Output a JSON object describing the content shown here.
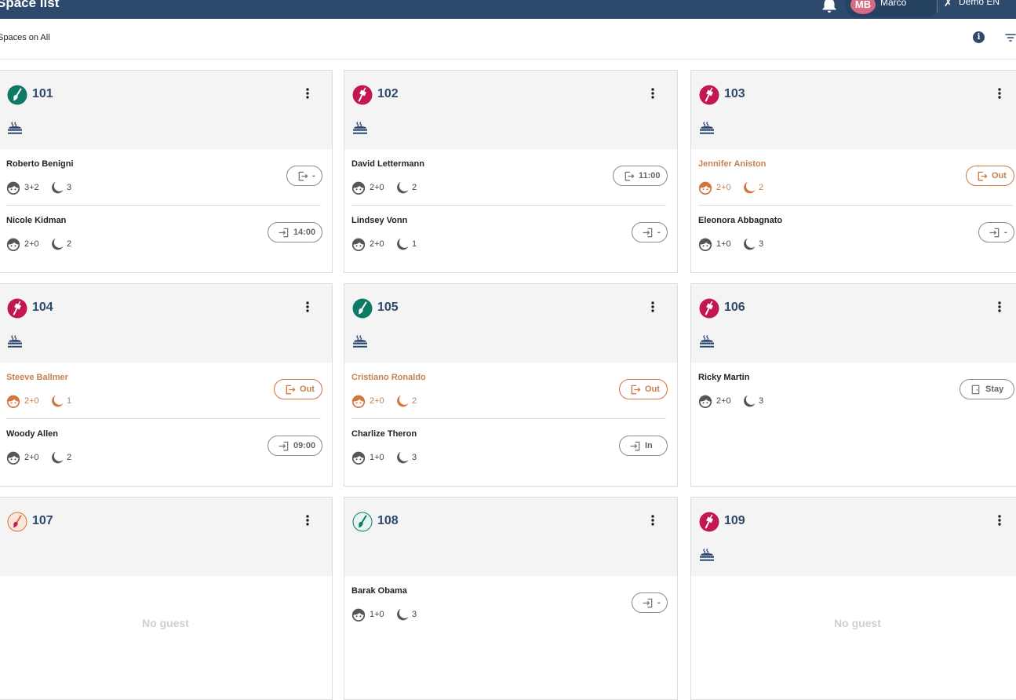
{
  "header": {
    "title": "Space list",
    "user_initials": "MB",
    "user_name": "Marco",
    "hotel": "Demo EN"
  },
  "subheader": {
    "label": "Spaces on All"
  },
  "colors": {
    "primary": "#2d4a6d",
    "dirty": "#c2184f",
    "clean": "#0d7a68",
    "accent_orange": "#d2763f"
  },
  "rooms": [
    {
      "number": "101",
      "status": "clean-icon",
      "bed": true,
      "no_guest": "",
      "guests": [
        {
          "name": "Roberto Benigni",
          "people": "3+2",
          "nights": "3",
          "action": "-",
          "icon": "checkout-icon",
          "highlight": false
        },
        {
          "name": "Nicole Kidman",
          "people": "2+0",
          "nights": "2",
          "action": "14:00",
          "icon": "checkin-icon",
          "highlight": false
        }
      ]
    },
    {
      "number": "102",
      "status": "dirty-icon",
      "bed": true,
      "no_guest": "",
      "guests": [
        {
          "name": "David Lettermann",
          "people": "2+0",
          "nights": "2",
          "action": "11:00",
          "icon": "checkout-icon",
          "highlight": false
        },
        {
          "name": "Lindsey Vonn",
          "people": "2+0",
          "nights": "1",
          "action": "-",
          "icon": "checkin-icon",
          "highlight": false
        }
      ]
    },
    {
      "number": "103",
      "status": "dirty-icon",
      "bed": true,
      "no_guest": "",
      "guests": [
        {
          "name": "Jennifer Aniston",
          "people": "2+0",
          "nights": "2",
          "action": "Out",
          "icon": "checkout-icon",
          "highlight": true
        },
        {
          "name": "Eleonora Abbagnato",
          "people": "1+0",
          "nights": "3",
          "action": "-",
          "icon": "checkin-icon",
          "highlight": false
        }
      ]
    },
    {
      "number": "104",
      "status": "dirty-icon",
      "bed": true,
      "no_guest": "",
      "guests": [
        {
          "name": "Steeve Ballmer",
          "people": "2+0",
          "nights": "1",
          "action": "Out",
          "icon": "checkout-icon",
          "highlight": true
        },
        {
          "name": "Woody Allen",
          "people": "2+0",
          "nights": "2",
          "action": "09:00",
          "icon": "checkin-icon",
          "highlight": false
        }
      ]
    },
    {
      "number": "105",
      "status": "clean-icon",
      "bed": true,
      "no_guest": "",
      "guests": [
        {
          "name": "Cristiano Ronaldo",
          "people": "2+0",
          "nights": "2",
          "action": "Out",
          "icon": "checkout-icon",
          "highlight": true
        },
        {
          "name": "Charlize Theron",
          "people": "1+0",
          "nights": "3",
          "action": "In",
          "icon": "checkin-icon",
          "highlight": false
        }
      ]
    },
    {
      "number": "106",
      "status": "dirty-icon",
      "bed": true,
      "no_guest": "",
      "guests": [
        {
          "name": "Ricky Martin",
          "people": "2+0",
          "nights": "3",
          "action": "Stay",
          "icon": "stay-icon",
          "highlight": false
        }
      ]
    },
    {
      "number": "107",
      "status": "inspect-icon",
      "bed": false,
      "no_guest": "No guest",
      "guests": []
    },
    {
      "number": "108",
      "status": "clean-outline-icon",
      "bed": false,
      "no_guest": "",
      "guests": [
        {
          "name": "Barak Obama",
          "people": "1+0",
          "nights": "3",
          "action": "-",
          "icon": "checkin-icon",
          "highlight": false
        }
      ]
    },
    {
      "number": "109",
      "status": "dirty-icon",
      "bed": true,
      "no_guest": "No guest",
      "guests": []
    }
  ]
}
